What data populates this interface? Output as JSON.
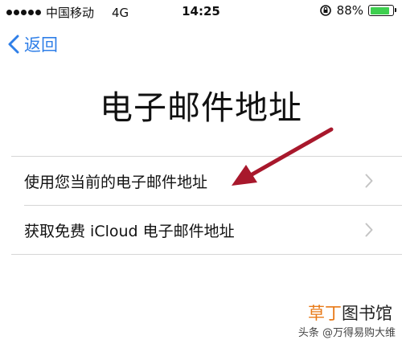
{
  "status_bar": {
    "carrier": "中国移动",
    "network": "4G",
    "time": "14:25",
    "battery_percent": "88%",
    "battery_level": 0.88,
    "battery_color": "#3ecf4f"
  },
  "nav": {
    "back_label": "返回",
    "accent_color": "#2f7fe8"
  },
  "page": {
    "title": "电子邮件地址"
  },
  "options": [
    {
      "label": "使用您当前的电子邮件地址"
    },
    {
      "label": "获取免费 iCloud 电子邮件地址"
    }
  ],
  "annotation": {
    "arrow_color": "#a8182c"
  },
  "watermark": {
    "brand_orange": "草丁",
    "brand_dark": "图书馆",
    "source_prefix": "头条",
    "source_name": "@万得易购大维"
  }
}
